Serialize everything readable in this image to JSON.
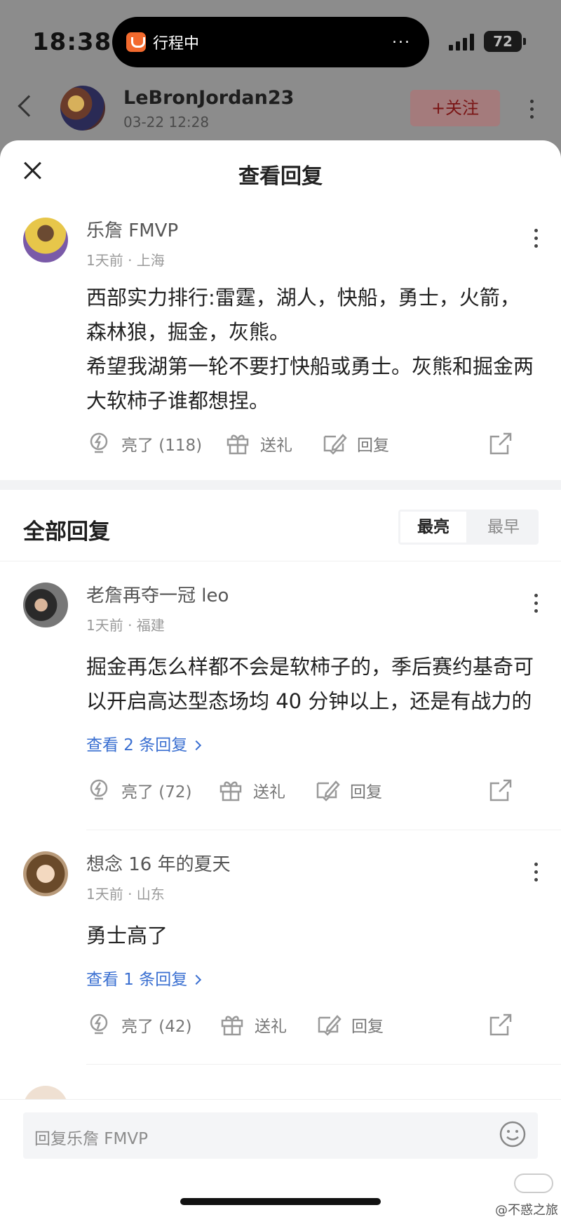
{
  "status_bar": {
    "time": "18:38",
    "island_text": "行程中",
    "island_more": "...",
    "battery": "72"
  },
  "top_nav": {
    "user_name": "LeBronJordan23",
    "date": "03-22 12:28",
    "follow_label": "+关注"
  },
  "sheet": {
    "title": "查看回复"
  },
  "main_comment": {
    "name": "乐詹 FMVP",
    "meta": "1天前 · 上海",
    "text_line1": "西部实力排行:雷霆，湖人，快船，勇士，火箭，森林狼，掘金，灰熊。",
    "text_line2": "希望我湖第一轮不要打快船或勇士。灰熊和掘金两大软柿子谁都想捏。",
    "like_label": "亮了 (118)",
    "gift_label": "送礼",
    "reply_label": "回复"
  },
  "replies_section": {
    "title": "全部回复",
    "sort_options": [
      "最亮",
      "最早"
    ]
  },
  "replies": [
    {
      "name": "老詹再夺一冠 leo",
      "meta": "1天前 · 福建",
      "text": "掘金再怎么样都不会是软柿子的，季后赛约基奇可以开启高达型态场均 40 分钟以上，还是有战力的",
      "view_replies": "查看 2 条回复",
      "like_label": "亮了 (72)",
      "gift_label": "送礼",
      "reply_label": "回复"
    },
    {
      "name": "想念 16 年的夏天",
      "meta": "1天前 · 山东",
      "text": "勇士高了",
      "view_replies": "查看 1 条回复",
      "like_label": "亮了 (42)",
      "gift_label": "送礼",
      "reply_label": "回复"
    }
  ],
  "input_bar": {
    "placeholder": "回复乐詹 FMVP"
  },
  "watermark": "@不惑之旅",
  "colors": {
    "link_blue": "#3a6fd1",
    "follow_red": "#7a1515",
    "overlay_gray": "#8c8c8c"
  }
}
